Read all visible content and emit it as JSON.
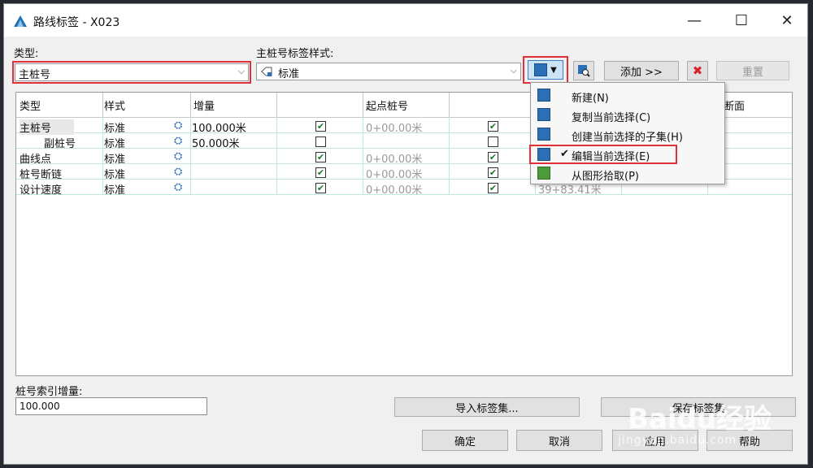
{
  "window": {
    "title": "路线标签 - X023",
    "minimize_glyph": "—",
    "maximize_glyph": "☐",
    "close_glyph": "✕"
  },
  "type_section": {
    "label": "类型:",
    "selected": "主桩号"
  },
  "style_section": {
    "label": "主桩号标签样式:",
    "selected": "标准"
  },
  "toolbar": {
    "add_label": "添加 >>",
    "reset_label": "重置"
  },
  "grid": {
    "columns": [
      "类型",
      "样式",
      "增量",
      "",
      "起点桩号",
      "",
      "",
      "",
      "断面"
    ],
    "rows": [
      {
        "type": "主桩号",
        "style": "标准",
        "increment": "100.000米",
        "checked1": true,
        "start": "0+00.00米",
        "checked2": true,
        "end": ""
      },
      {
        "type": "副桩号",
        "style": "标准",
        "increment": "50.000米",
        "checked1": false,
        "start": "",
        "checked2": false,
        "end": ""
      },
      {
        "type": "曲线点",
        "style": "标准",
        "increment": "",
        "checked1": true,
        "start": "0+00.00米",
        "checked2": true,
        "end": ""
      },
      {
        "type": "桩号断链",
        "style": "标准",
        "increment": "",
        "checked1": true,
        "start": "0+00.00米",
        "checked2": true,
        "end": ""
      },
      {
        "type": "设计速度",
        "style": "标准",
        "increment": "",
        "checked1": true,
        "start": "0+00.00米",
        "checked2": true,
        "end": "39+83.41米"
      }
    ]
  },
  "menu": {
    "items": [
      {
        "label": "新建(N)",
        "icon": "new-style-icon",
        "checked": false
      },
      {
        "label": "复制当前选择(C)",
        "icon": "copy-style-icon",
        "checked": false
      },
      {
        "label": "创建当前选择的子集(H)",
        "icon": "child-style-icon",
        "checked": false
      },
      {
        "label": "编辑当前选择(E)",
        "icon": "edit-style-icon",
        "checked": true
      },
      {
        "label": "从图形拾取(P)",
        "icon": "pick-from-drawing-icon",
        "checked": false
      }
    ]
  },
  "index_increment": {
    "label": "桩号索引增量:",
    "value": "100.000"
  },
  "buttons": {
    "import": "导入标签集...",
    "save": "保存标签集",
    "ok": "确定",
    "cancel": "取消",
    "apply": "应用",
    "help": "帮助"
  },
  "watermark": {
    "text": "Baidu经验",
    "sub": "jingyan.baidu.com"
  },
  "colors": {
    "highlight": "#e0303a",
    "grid_line": "#bfe6e0",
    "icon_blue": "#2b6fb6"
  }
}
